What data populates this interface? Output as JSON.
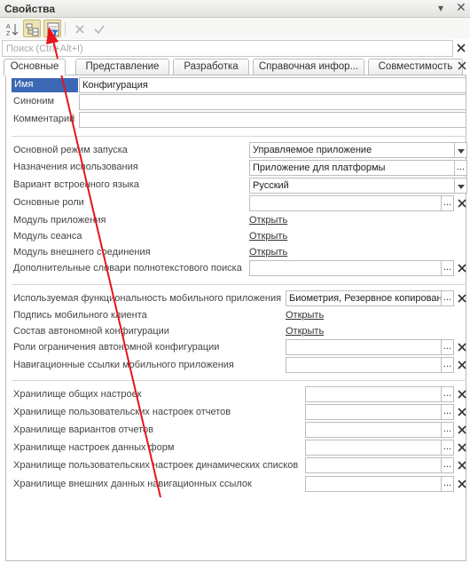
{
  "window": {
    "title": "Свойства"
  },
  "search": {
    "placeholder": "Поиск (Ctrl+Alt+I)"
  },
  "tabs": [
    "Основные",
    "Представление",
    "Разработка",
    "Справочная инфор...",
    "Совместимость"
  ],
  "general": {
    "name_label": "Имя",
    "name_value": "Конфигурация",
    "synonym_label": "Синоним",
    "synonym_value": "",
    "comment_label": "Комментарий",
    "comment_value": ""
  },
  "launch": {
    "mode_label": "Основной режим запуска",
    "mode_value": "Управляемое приложение",
    "purpose_label": "Назначения использования",
    "purpose_value": "Приложение для платформы",
    "script_label": "Вариант встроенного языка",
    "script_value": "Русский",
    "roles_label": "Основные роли",
    "roles_value": "",
    "app_module_label": "Модуль приложения",
    "app_module_link": "Открыть",
    "session_module_label": "Модуль сеанса",
    "session_module_link": "Открыть",
    "ext_conn_module_label": "Модуль внешнего соединения",
    "ext_conn_module_link": "Открыть",
    "fulltext_label": "Дополнительные словари полнотекстового поиска",
    "fulltext_value": ""
  },
  "mobile": {
    "functionality_label": "Используемая функциональность мобильного приложения",
    "functionality_value": "Биометрия, Резервное копирован",
    "signature_label": "Подпись мобильного клиента",
    "signature_link": "Открыть",
    "standalone_label": "Состав автономной конфигурации",
    "standalone_link": "Открыть",
    "roles_label": "Роли ограничения автономной конфигурации",
    "roles_value": "",
    "navlinks_label": "Навигационные ссылки мобильного приложения",
    "navlinks_value": ""
  },
  "storages": [
    {
      "label": "Хранилище общих настроек",
      "value": ""
    },
    {
      "label": "Хранилище пользовательских настроек отчетов",
      "value": ""
    },
    {
      "label": "Хранилище вариантов отчетов",
      "value": ""
    },
    {
      "label": "Хранилище настроек данных форм",
      "value": ""
    },
    {
      "label": "Хранилище пользовательских настроек динамических списков",
      "value": ""
    },
    {
      "label": "Хранилище внешних данных навигационных ссылок",
      "value": ""
    }
  ],
  "colors": {
    "selection": "#3c67b4",
    "annotation_arrow": "#e8141c",
    "clear_x": "#333333"
  }
}
